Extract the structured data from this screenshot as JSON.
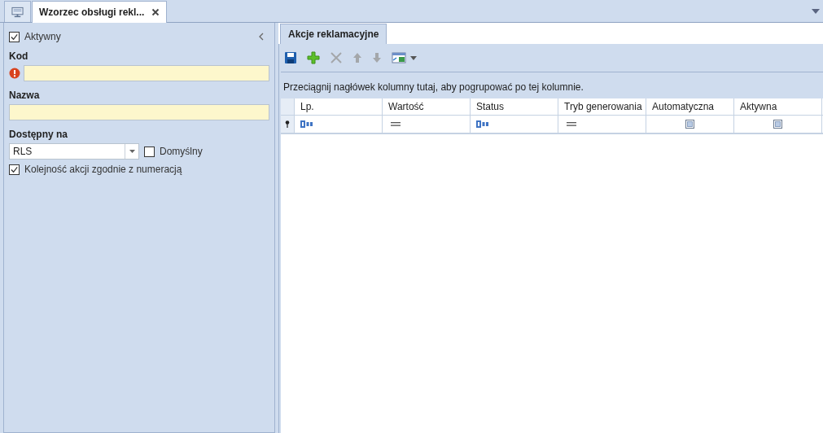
{
  "document_tabs": [
    {
      "kind": "icon",
      "selected": false
    },
    {
      "kind": "text",
      "label": "Wzorzec obsługi rekl...",
      "selected": true,
      "closable": true
    }
  ],
  "form": {
    "active": {
      "label": "Aktywny",
      "checked": true
    },
    "code": {
      "label": "Kod",
      "required": true
    },
    "name": {
      "label": "Nazwa"
    },
    "available_on": {
      "label": "Dostępny na",
      "value": "RLS",
      "default": {
        "label": "Domyślny",
        "checked": false
      }
    },
    "order_by_numbering": {
      "label": "Kolejność akcji zgodnie z numeracją",
      "checked": true
    }
  },
  "panel_tabs": [
    {
      "label": "Akcje reklamacyjne",
      "selected": true
    }
  ],
  "toolbar": [
    {
      "kind": "save",
      "disabled": false
    },
    {
      "kind": "add",
      "disabled": false
    },
    {
      "kind": "delete",
      "disabled": true
    },
    {
      "kind": "up",
      "disabled": true
    },
    {
      "kind": "down",
      "disabled": true
    },
    {
      "kind": "export",
      "disabled": false
    }
  ],
  "grid": {
    "group_hint": "Przeciągnij nagłówek kolumny tutaj, aby pogrupować po tej kolumnie.",
    "columns": [
      {
        "label": "Lp.",
        "kind": "text"
      },
      {
        "label": "Wartość",
        "kind": "equals"
      },
      {
        "label": "Status",
        "kind": "text"
      },
      {
        "label": "Tryb generowania",
        "kind": "equals"
      },
      {
        "label": "Automatyczna",
        "kind": "checkbox"
      },
      {
        "label": "Aktywna",
        "kind": "checkbox"
      }
    ]
  }
}
